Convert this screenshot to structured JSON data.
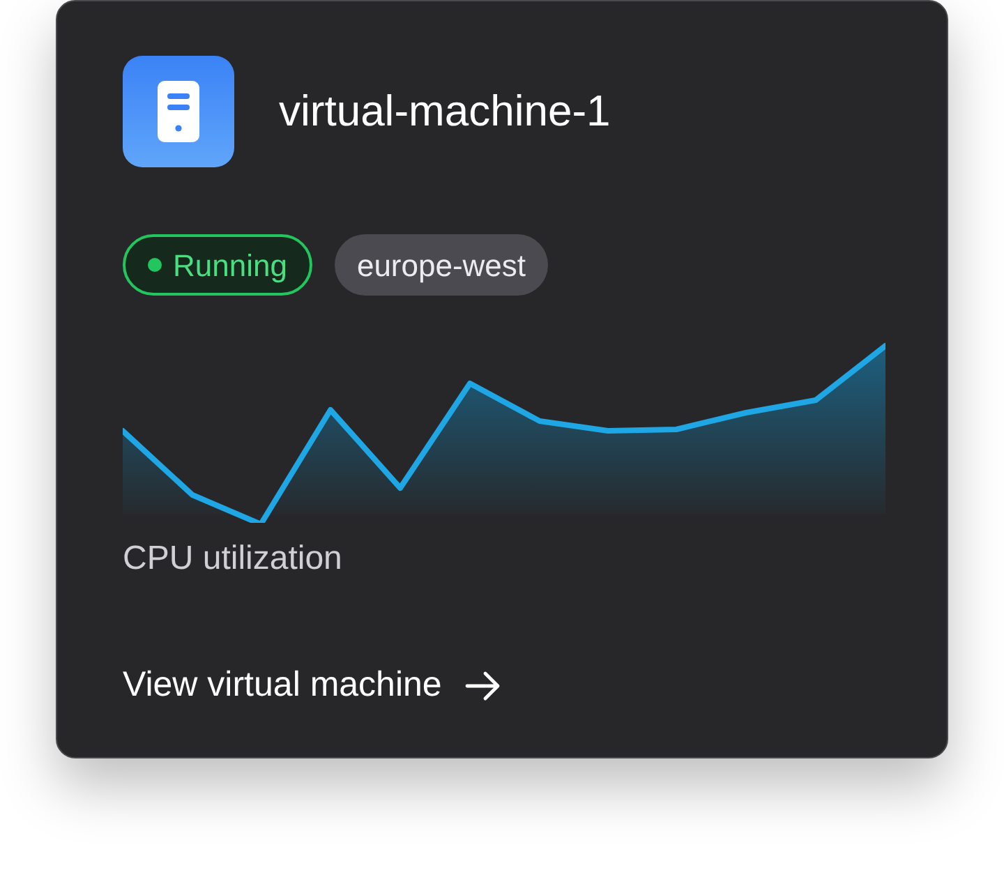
{
  "card": {
    "title": "virtual-machine-1",
    "tags": [
      {
        "kind": "status",
        "label": "Running"
      },
      {
        "kind": "region",
        "label": "europe-west"
      }
    ],
    "chart_caption": "CPU utilization",
    "link": "View virtual machine"
  }
}
